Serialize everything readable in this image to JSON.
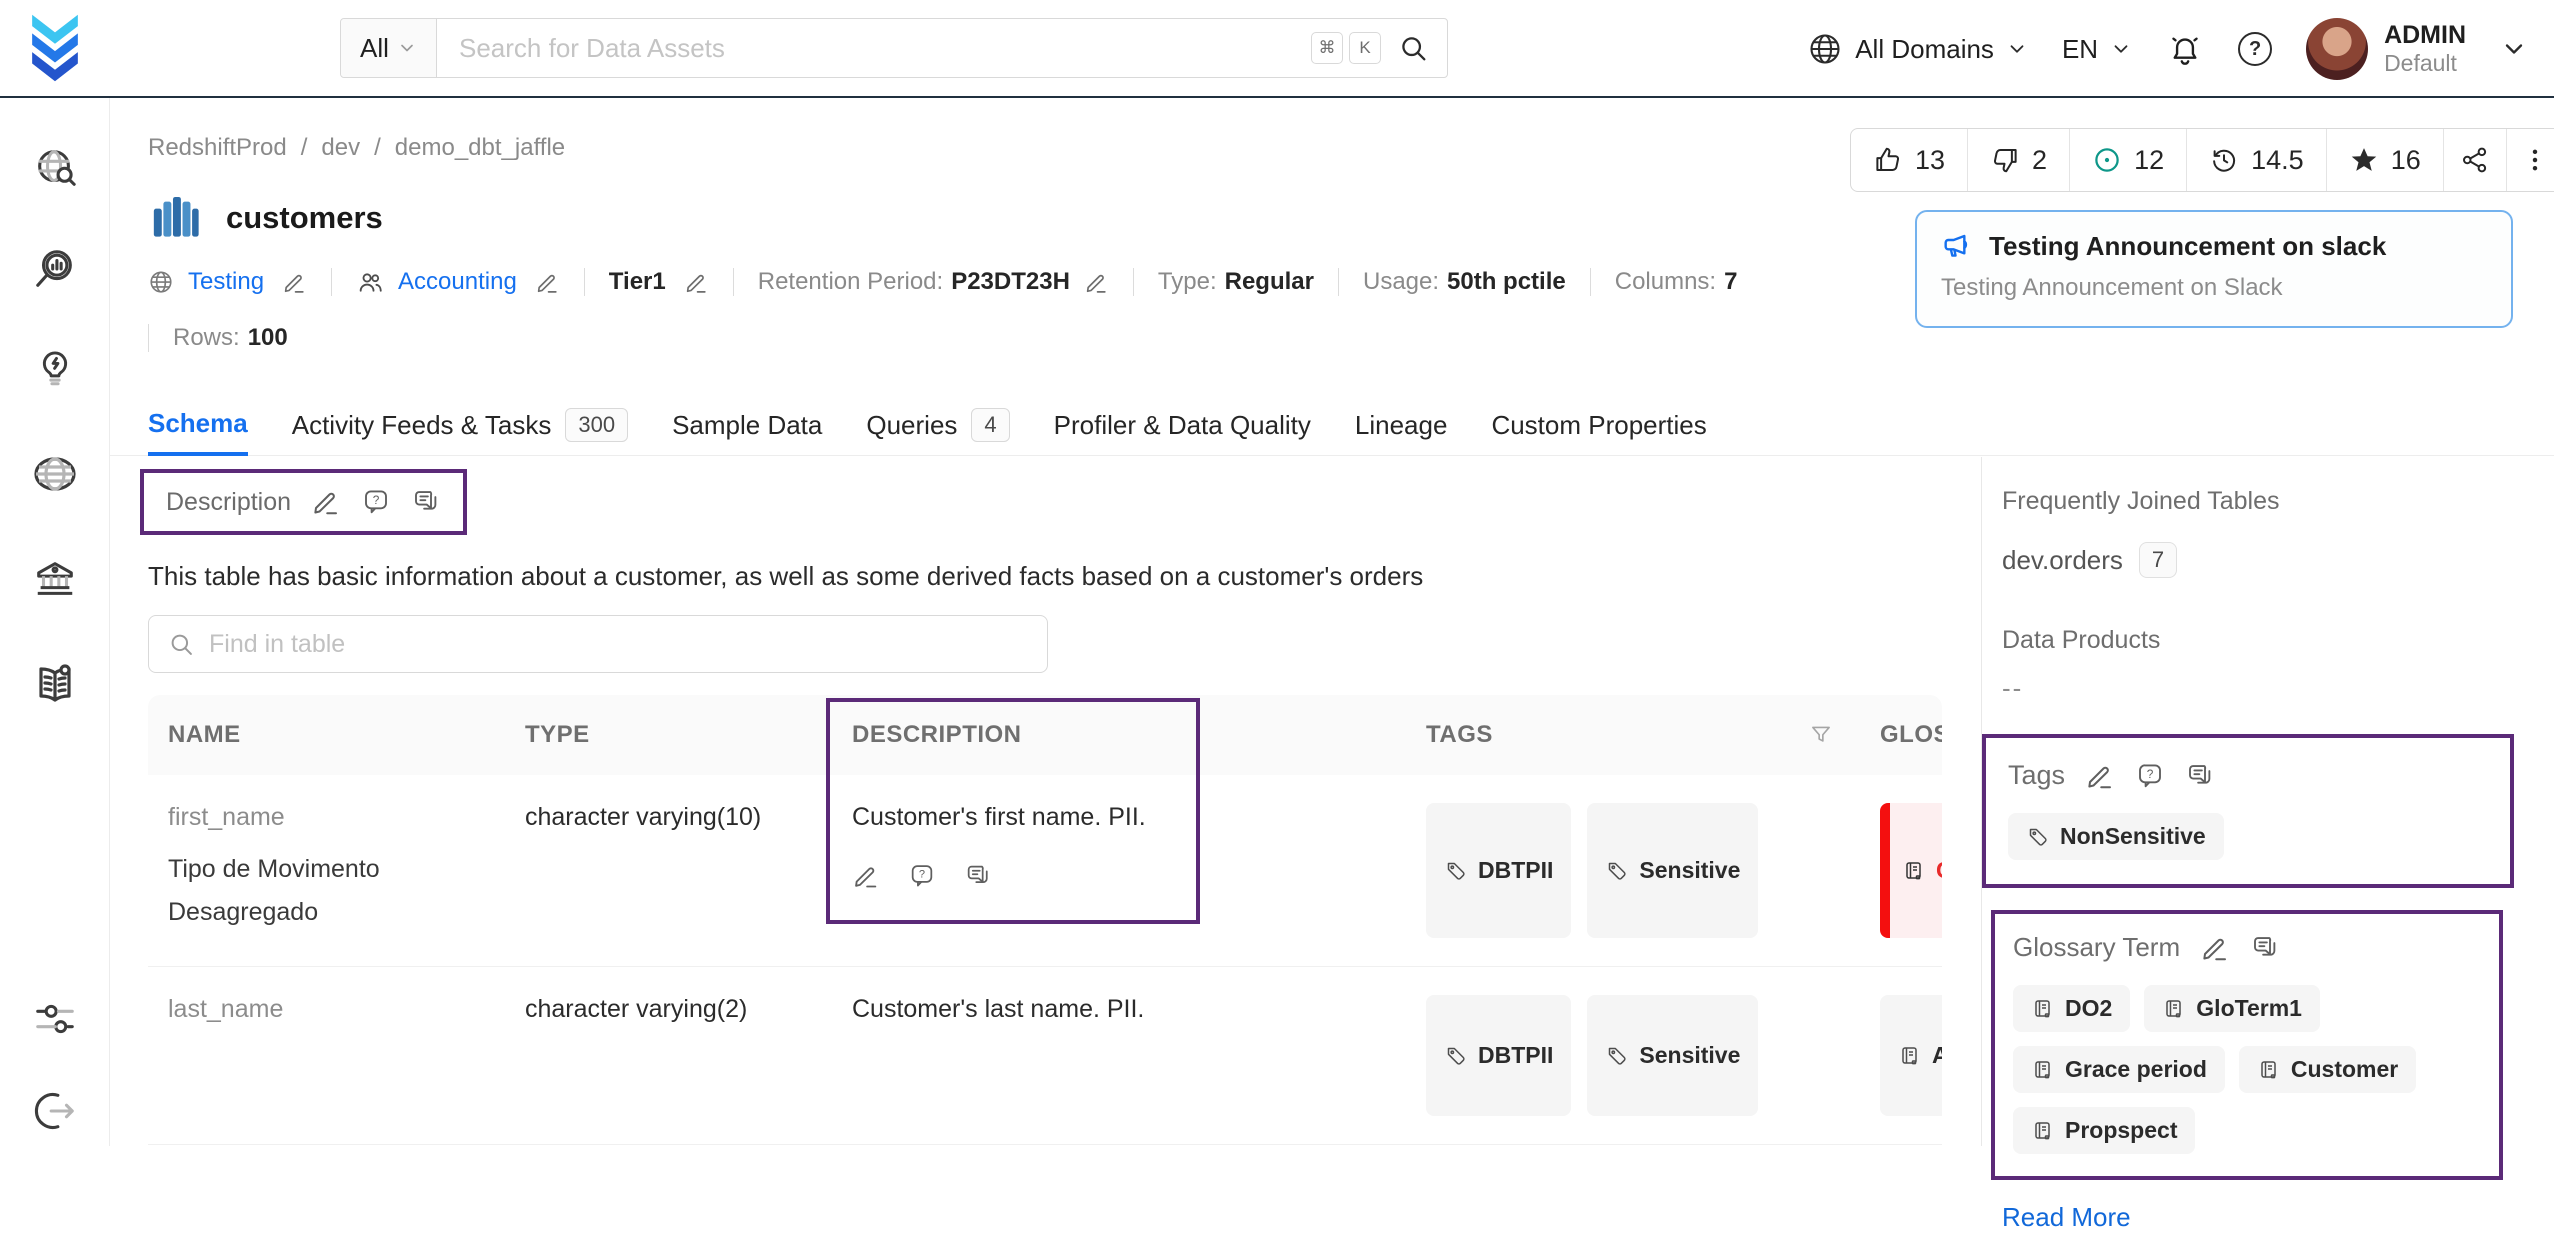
{
  "colors": {
    "accent_blue": "#1570ef",
    "annotation_purple": "#5b2a78",
    "task_teal": "#0e9789",
    "glossary_red": "#f40f0f",
    "announcement_border": "#74b2ee"
  },
  "topbar": {
    "search": {
      "filter_label": "All",
      "placeholder": "Search for Data Assets",
      "shortcut_key_1": "⌘",
      "shortcut_key_2": "K"
    },
    "domains_label": "All Domains",
    "language_label": "EN",
    "user": {
      "name": "ADMIN",
      "role": "Default"
    }
  },
  "sidebar": {
    "items": [
      "explore-search",
      "observability",
      "insights",
      "domains",
      "governance",
      "glossary",
      "settings",
      "logout"
    ]
  },
  "breadcrumb": {
    "items": [
      "RedshiftProd",
      "dev",
      "demo_dbt_jaffle"
    ],
    "separator": "/"
  },
  "entity": {
    "title": "customers",
    "stats": {
      "upvotes": "13",
      "downvotes": "2",
      "open_tasks": "12",
      "version": "14.5",
      "followers": "16"
    },
    "announcement": {
      "title": "Testing Announcement on slack",
      "subtitle": "Testing Announcement on Slack"
    },
    "meta": {
      "domain": "Testing",
      "owner": "Accounting",
      "tier": "Tier1",
      "retention_label": "Retention Period:",
      "retention_value": "P23DT23H",
      "type_label": "Type:",
      "type_value": "Regular",
      "usage_label": "Usage:",
      "usage_value": "50th pctile",
      "columns_label": "Columns:",
      "columns_value": "7",
      "rows_label": "Rows:",
      "rows_value": "100"
    }
  },
  "tabs": [
    {
      "label": "Schema"
    },
    {
      "label": "Activity Feeds & Tasks",
      "count": "300"
    },
    {
      "label": "Sample Data"
    },
    {
      "label": "Queries",
      "count": "4"
    },
    {
      "label": "Profiler & Data Quality"
    },
    {
      "label": "Lineage"
    },
    {
      "label": "Custom Properties"
    }
  ],
  "schema": {
    "description_heading": "Description",
    "description_text": "This table has basic information about a customer, as well as some derived facts based on a customer's orders",
    "find_placeholder": "Find in table",
    "table": {
      "headers": [
        "NAME",
        "TYPE",
        "DESCRIPTION",
        "TAGS",
        "GLOS"
      ],
      "rows": [
        {
          "name": "first_name",
          "display_name": "Tipo de Movimento Desagregado",
          "type": "character varying(10)",
          "description": "Customer's first name. PII.",
          "tags": [
            "DBTPII",
            "Sensitive"
          ],
          "glossary": "C"
        },
        {
          "name": "last_name",
          "display_name": "",
          "type": "character varying(2)",
          "description": "Customer's last name. PII.",
          "tags": [
            "DBTPII",
            "Sensitive"
          ],
          "glossary": "Ac"
        }
      ]
    }
  },
  "right_panel": {
    "joined_heading": "Frequently Joined Tables",
    "joined_table": "dev.orders",
    "joined_count": "7",
    "data_products_heading": "Data Products",
    "data_products_value": "--",
    "tags_heading": "Tags",
    "tags": [
      "NonSensitive"
    ],
    "glossary_heading": "Glossary Term",
    "glossary_terms": [
      "DO2",
      "GloTerm1",
      "Grace period",
      "Customer",
      "Propspect"
    ],
    "read_more_label": "Read More"
  }
}
